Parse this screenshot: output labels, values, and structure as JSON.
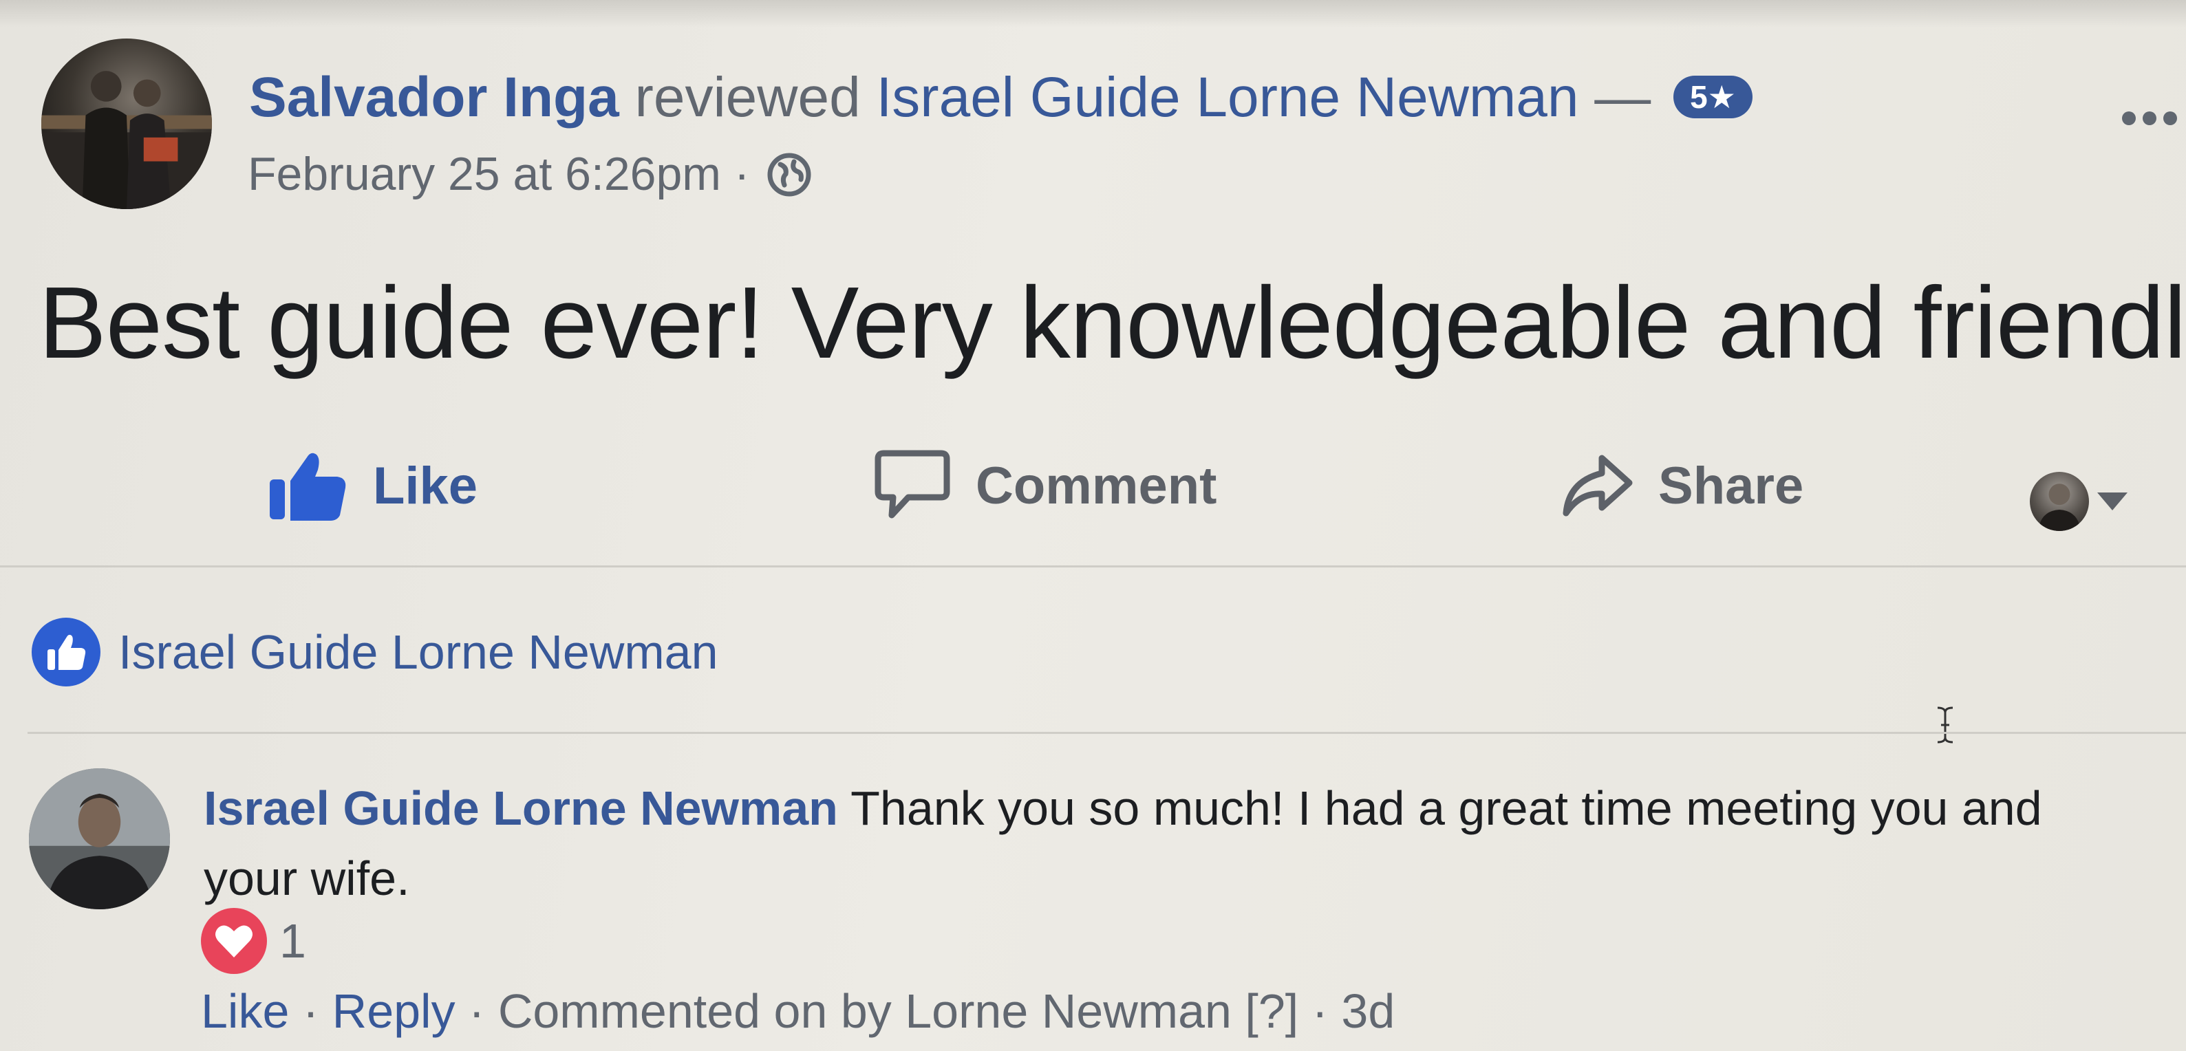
{
  "post": {
    "author": "Salvador Inga",
    "verb": "reviewed",
    "page": "Israel Guide Lorne Newman",
    "dash": "—",
    "rating": "5★",
    "timestamp": "February 25 at 6:26pm",
    "separator": "·",
    "privacy_icon": "globe-icon",
    "text": "Best guide ever! Very knowledgeable and friendly."
  },
  "actions": {
    "like": "Like",
    "comment": "Comment",
    "share": "Share"
  },
  "liked_by": {
    "name": "Israel Guide Lorne Newman"
  },
  "reply": {
    "author": "Israel Guide Lorne Newman",
    "text": "Thank you so much! I had a great time meeting you and your wife.",
    "reaction_count": "1",
    "like": "Like",
    "reply_label": "Reply",
    "sep": "·",
    "commented_by": "Commented on by Lorne Newman [?]",
    "time": "3d"
  },
  "colors": {
    "brand_blue": "#385898",
    "like_blue": "#2d5ed1",
    "love_red": "#e8445a",
    "meta_gray": "#616770"
  }
}
